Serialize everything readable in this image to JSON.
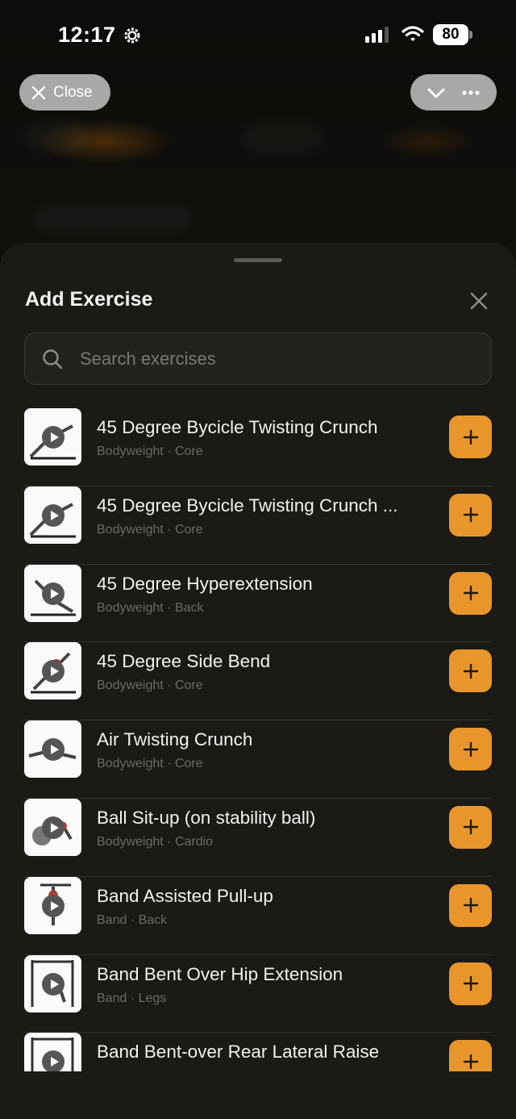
{
  "status_bar": {
    "time": "12:17",
    "battery": "80"
  },
  "top_bar": {
    "close_label": "Close"
  },
  "sheet": {
    "title": "Add Exercise",
    "search_placeholder": "Search exercises"
  },
  "exercises": [
    {
      "name": "45 Degree Bycicle Twisting Crunch",
      "meta": "Bodyweight · Core"
    },
    {
      "name": "45 Degree Bycicle Twisting Crunch ...",
      "meta": "Bodyweight · Core"
    },
    {
      "name": "45 Degree Hyperextension",
      "meta": "Bodyweight · Back"
    },
    {
      "name": "45 Degree Side Bend",
      "meta": "Bodyweight · Core"
    },
    {
      "name": "Air Twisting Crunch",
      "meta": "Bodyweight · Core"
    },
    {
      "name": "Ball Sit-up (on stability ball)",
      "meta": "Bodyweight · Cardio"
    },
    {
      "name": "Band Assisted Pull-up",
      "meta": "Band · Back"
    },
    {
      "name": "Band Bent Over Hip Extension",
      "meta": "Band · Legs"
    },
    {
      "name": "Band Bent-over Rear Lateral Raise",
      "meta": ""
    }
  ],
  "icons": {
    "status": [
      "gear-icon",
      "signal-icon",
      "wifi-icon",
      "battery-icon"
    ],
    "top": [
      "close-icon",
      "chevron-down-icon",
      "more-icon"
    ],
    "sheet": [
      "close-icon",
      "search-icon",
      "play-icon",
      "plus-icon"
    ]
  },
  "colors": {
    "accent": "#e8962c",
    "sheet_bg": "#1c1a17",
    "pill_bg": "#a9a8a6"
  }
}
